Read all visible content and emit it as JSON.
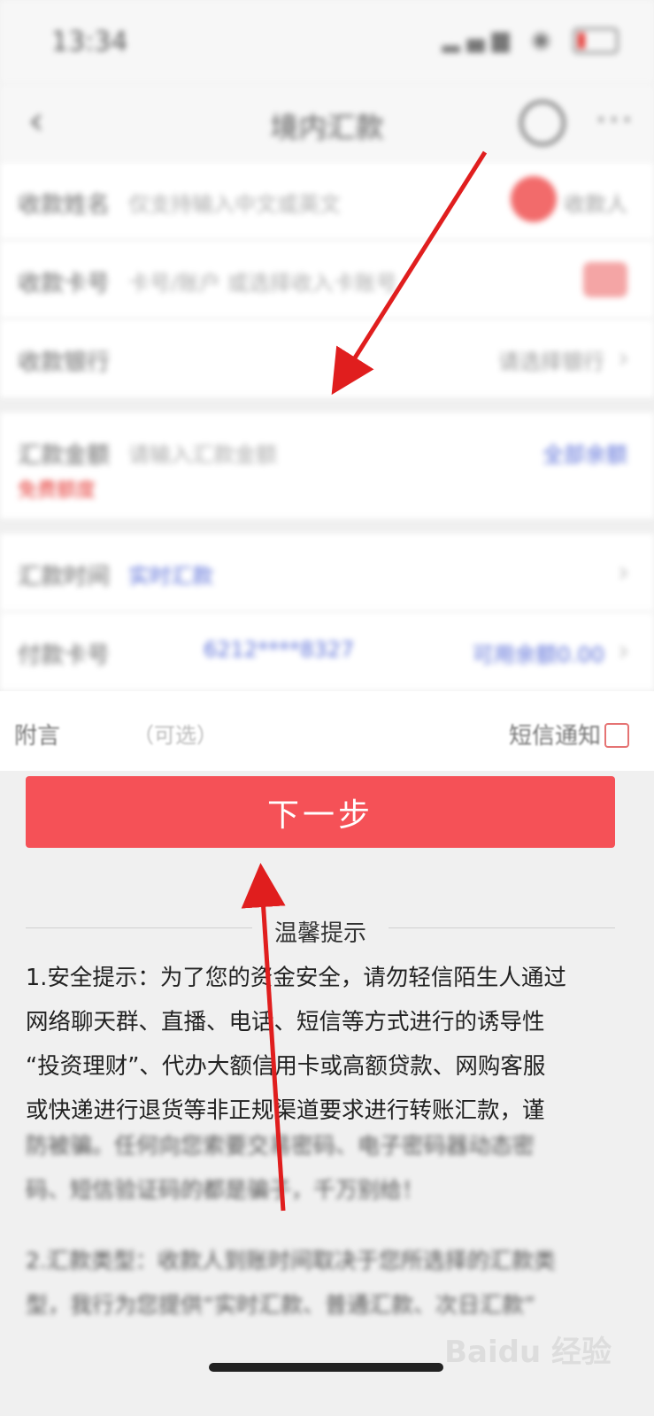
{
  "status_bar": {
    "time": "13:34",
    "signal_icons": "signal-wifi-icons",
    "battery": "battery-icon"
  },
  "nav": {
    "title": "境内汇款",
    "back_icon": "back-icon",
    "service_icon": "headset-icon",
    "more_icon": "more-icon"
  },
  "form": {
    "payee_name": {
      "label": "收款姓名",
      "placeholder": "仅支持输入中文或英文",
      "action": "收款人"
    },
    "payee_account": {
      "label": "收款卡号",
      "placeholder": "卡号/账户 或选择收入卡账号"
    },
    "payee_bank": {
      "label": "收款银行",
      "value": "请选择银行"
    },
    "amount": {
      "label": "汇款金额",
      "placeholder": "请输入汇款金额",
      "right": "全部余额",
      "sub": "免费额度"
    },
    "method": {
      "label": "汇款时间",
      "value": "实时汇款"
    },
    "pay_card": {
      "label": "付款卡号",
      "value": "6212****8327",
      "right": "可用余额0.00"
    },
    "remark": {
      "label": "附言",
      "placeholder": "（可选）",
      "sms": "短信通知"
    }
  },
  "next_button": "下一步",
  "tips": {
    "heading": "温馨提示",
    "lines": [
      "1.安全提示：为了您的资金安全，请勿轻信陌生人通过",
      "网络聊天群、直播、电话、短信等方式进行的诱导性",
      "“投资理财”、代办大额信用卡或高额贷款、网购客服",
      "或快递进行退货等非正规渠道要求进行转账汇款，谨"
    ],
    "blurred_lines": [
      "防被骗。任何向您索要交易密码、电子密码器动态密",
      "码、短信验证码的都是骗子，千万别给！"
    ],
    "blurred_lines_2": [
      "2.汇款类型：收款人到账时间取决于您所选择的汇款类",
      "型，我行为您提供“实时汇款、普通汇款、次日汇款”"
    ]
  },
  "watermark": "Baidu 经验",
  "colors": {
    "primary": "#f55157",
    "link": "#5b6fd8",
    "annotation_arrow": "#e01e1e"
  }
}
